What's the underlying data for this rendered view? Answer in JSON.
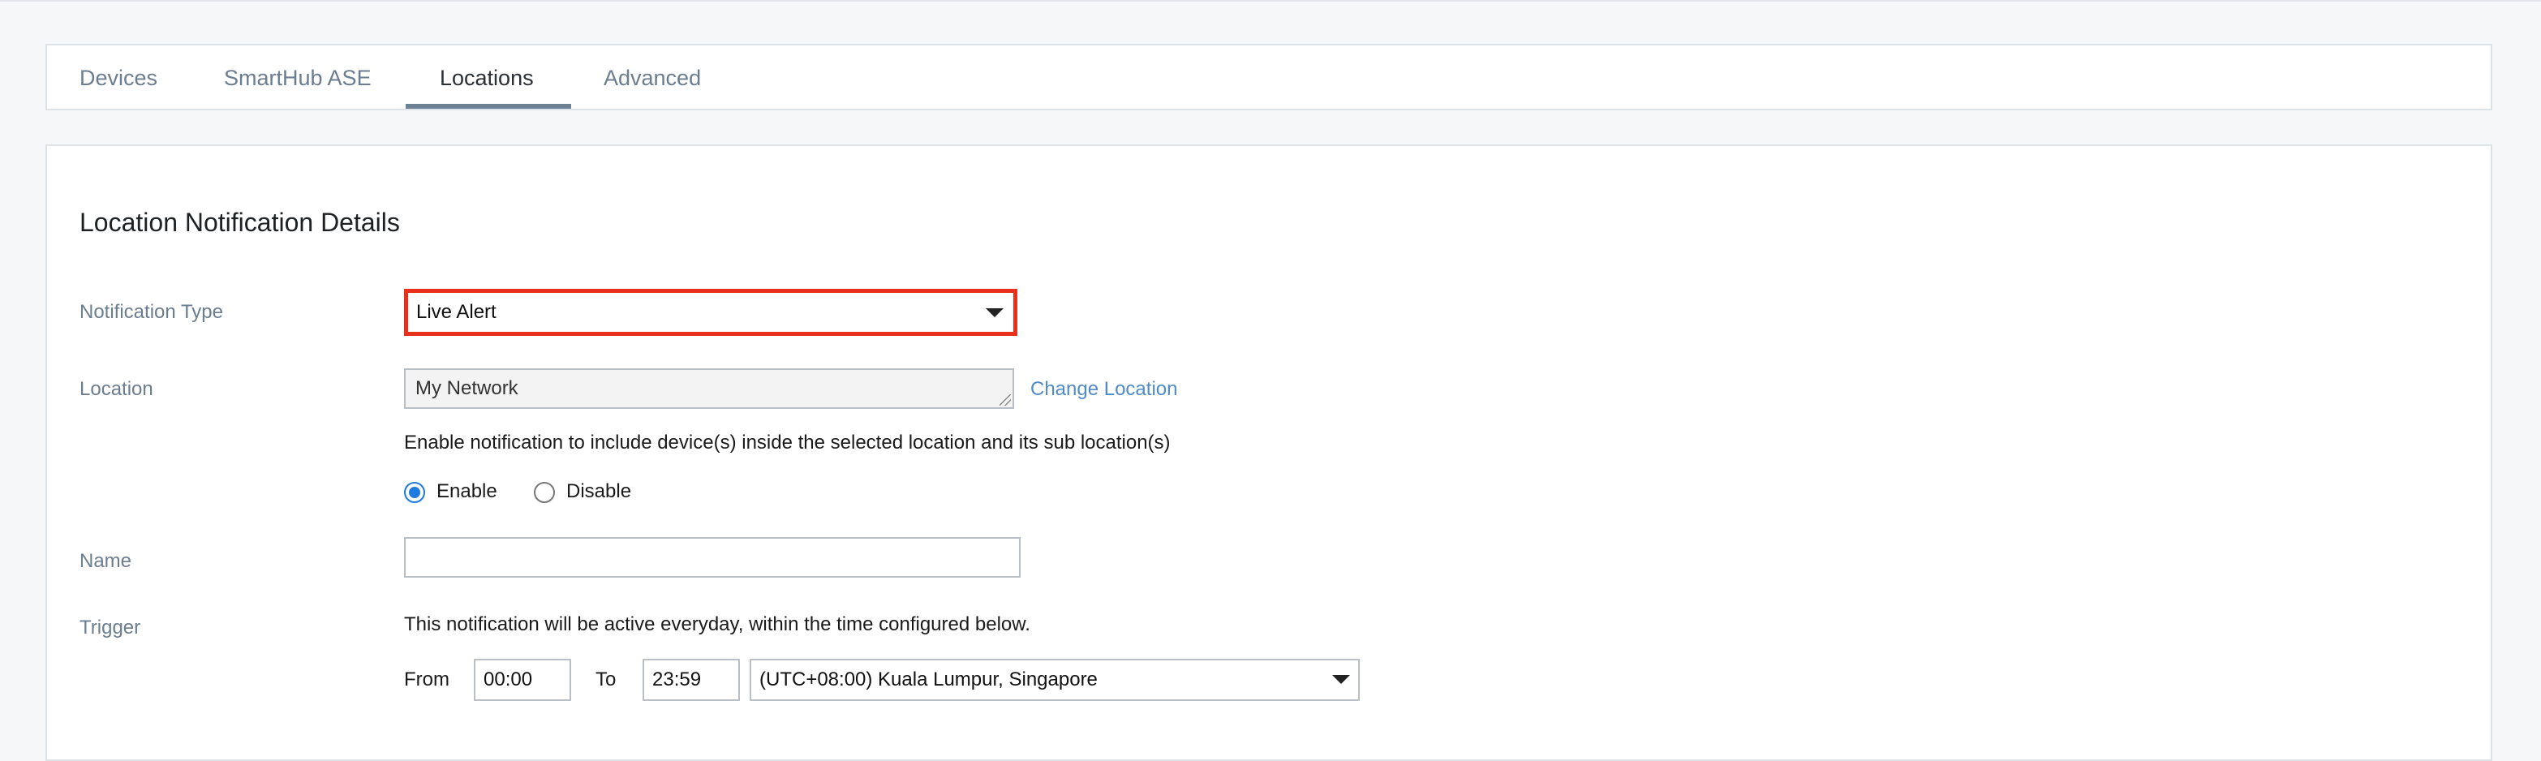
{
  "tabs": [
    {
      "label": "Devices",
      "active": false
    },
    {
      "label": "SmartHub ASE",
      "active": false
    },
    {
      "label": "Locations",
      "active": true
    },
    {
      "label": "Advanced",
      "active": false
    }
  ],
  "section_title": "Location Notification Details",
  "notification_type": {
    "label": "Notification Type",
    "value": "Live Alert",
    "highlight_color": "#e8301c"
  },
  "location": {
    "label": "Location",
    "value": "My Network",
    "change_link": "Change Location",
    "sub_location_text": "Enable notification to include device(s) inside the selected location and its sub location(s)",
    "enable_label": "Enable",
    "disable_label": "Disable",
    "selected": "Enable"
  },
  "name": {
    "label": "Name",
    "value": ""
  },
  "trigger": {
    "label": "Trigger",
    "description": "This notification will be active everyday, within the time configured below.",
    "from_label": "From",
    "from_value": "00:00",
    "to_label": "To",
    "to_value": "23:59",
    "timezone": "(UTC+08:00) Kuala Lumpur, Singapore"
  },
  "colors": {
    "accent": "#1f7ae0",
    "link": "#4f8bc9",
    "label": "#6b7d90",
    "tab_underline": "#6b8193"
  }
}
